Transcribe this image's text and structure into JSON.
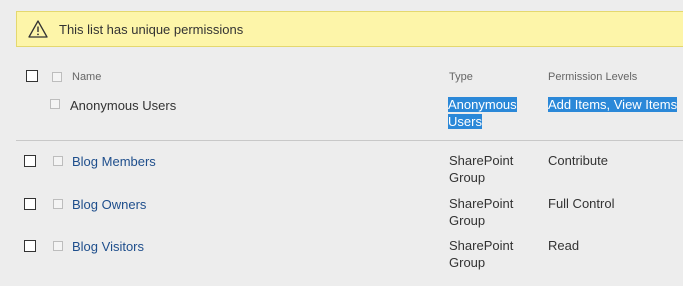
{
  "banner": {
    "icon": "warning-icon",
    "message": "This list has unique permissions"
  },
  "table": {
    "columns": {
      "name": "Name",
      "type": "Type",
      "permission_levels": "Permission Levels"
    },
    "rows": [
      {
        "name": "Anonymous Users",
        "type_line1": "Anonymous",
        "type_line2": "Users",
        "permission": "Add Items, View Items",
        "selected": true
      },
      {
        "name": "Blog Members",
        "type_line1": "SharePoint",
        "type_line2": "Group",
        "permission": "Contribute"
      },
      {
        "name": "Blog Owners",
        "type_line1": "SharePoint",
        "type_line2": "Group",
        "permission": "Full Control"
      },
      {
        "name": "Blog Visitors",
        "type_line1": "SharePoint",
        "type_line2": "Group",
        "permission": "Read"
      }
    ]
  },
  "colors": {
    "banner_bg": "#fdf5a9",
    "link": "#1e4e8c",
    "selection": "#2b88d8"
  }
}
